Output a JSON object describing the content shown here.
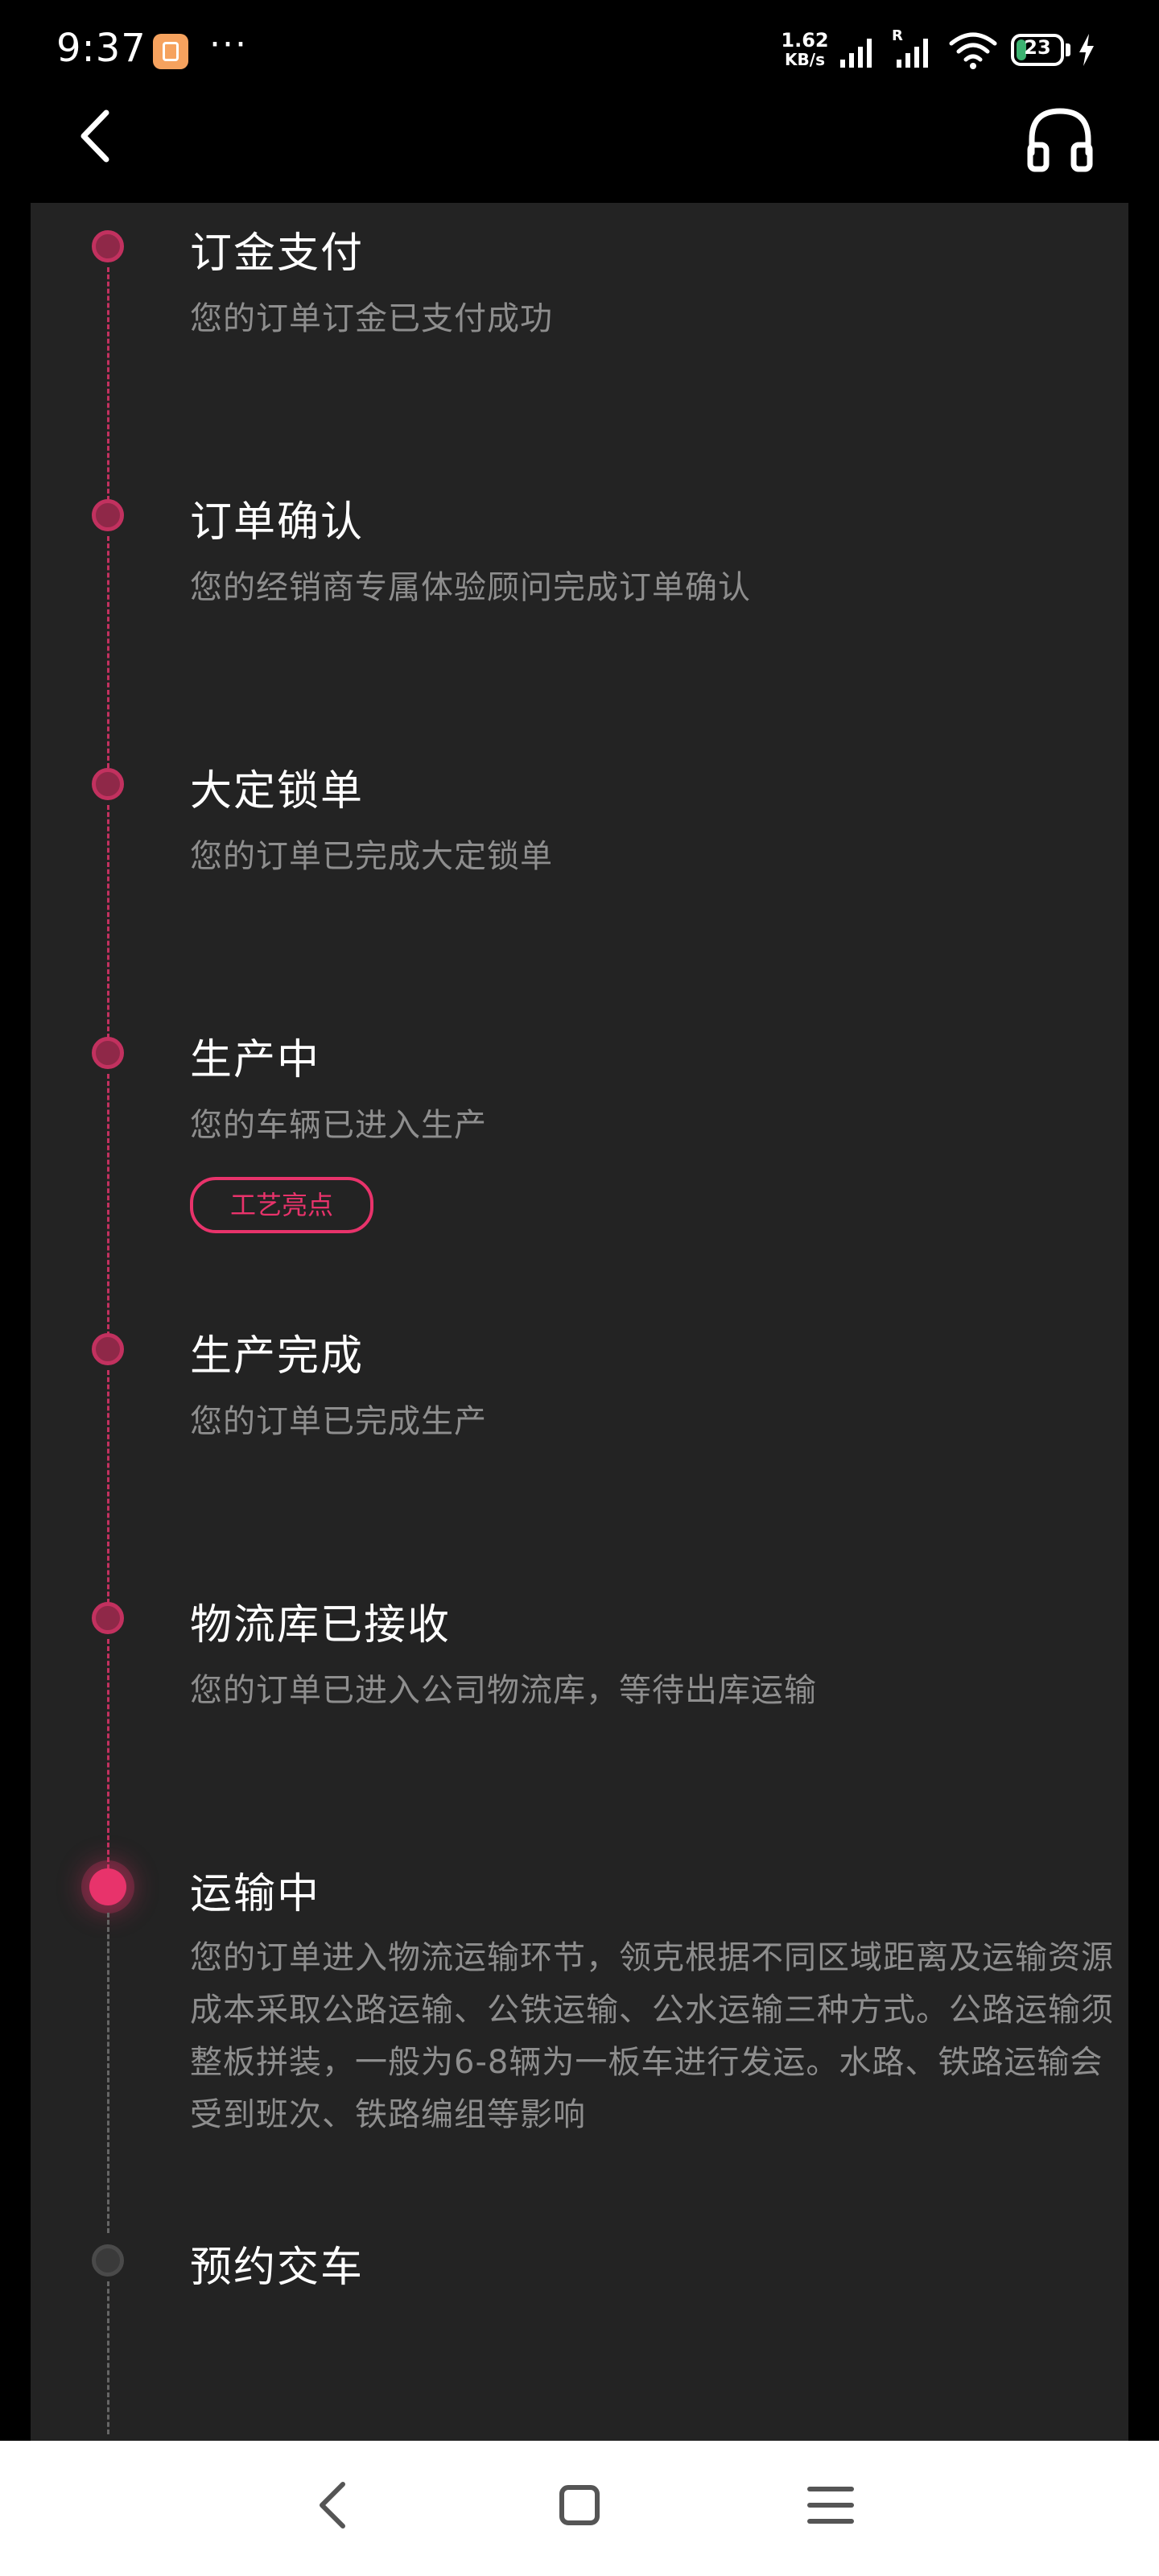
{
  "status_bar": {
    "time": "9:37",
    "more": "···",
    "net_speed_value": "1.62",
    "net_speed_unit": "KB/s",
    "roaming": "R",
    "battery": "23",
    "battery_percent": 23
  },
  "header": {
    "title": ""
  },
  "timeline": [
    {
      "title": "订金支付",
      "desc": "您的订单订金已支付成功",
      "status": "done"
    },
    {
      "title": "订单确认",
      "desc": "您的经销商专属体验顾问完成订单确认",
      "status": "done"
    },
    {
      "title": "大定锁单",
      "desc": "您的订单已完成大定锁单",
      "status": "done"
    },
    {
      "title": "生产中",
      "desc": "您的车辆已进入生产",
      "tag": "工艺亮点",
      "status": "done"
    },
    {
      "title": "生产完成",
      "desc": "您的订单已完成生产",
      "status": "done"
    },
    {
      "title": "物流库已接收",
      "desc": "您的订单已进入公司物流库，等待出库运输",
      "status": "done"
    },
    {
      "title": "运输中",
      "desc": "您的订单进入物流运输环节，领克根据不同区域距离及运输资源成本采取公路运输、公铁运输、公水运输三种方式。公路运输须整板拼装，一般为6-8辆为一板车进行发运。水路、铁路运输会受到班次、铁路编组等影响",
      "status": "active"
    },
    {
      "title": "预约交车",
      "desc": "",
      "status": "pending"
    }
  ],
  "colors": {
    "accent": "#e8336b",
    "dot_done": "#8f2848",
    "panel_bg": "#232323",
    "text_primary": "#ffffff",
    "text_secondary": "#8e8e8e"
  }
}
